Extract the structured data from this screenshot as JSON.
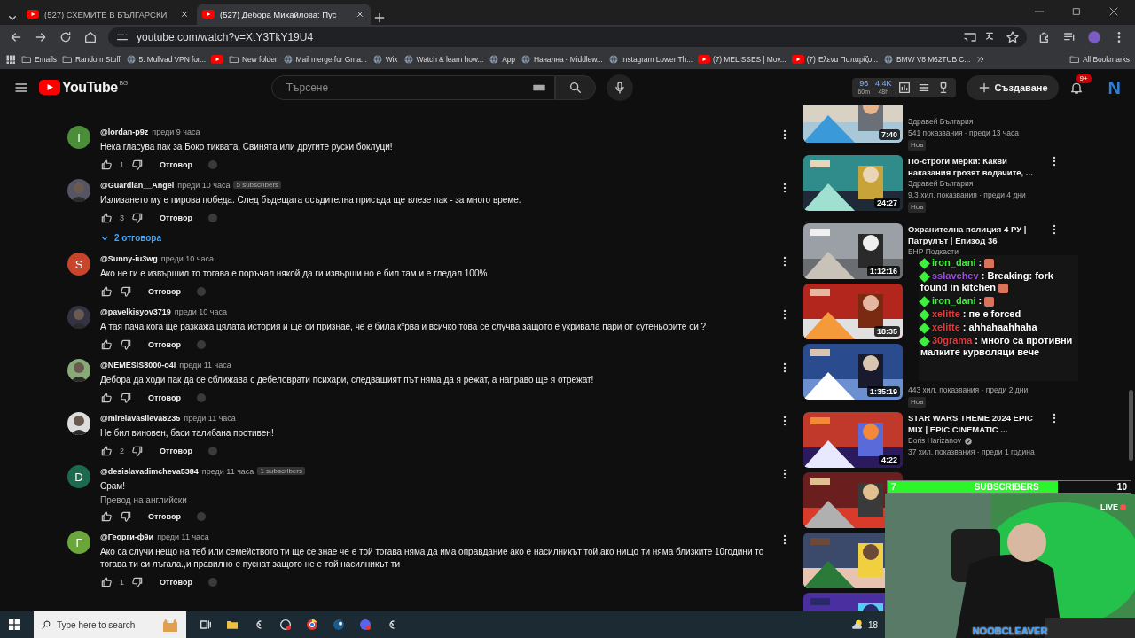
{
  "browser": {
    "tabs": [
      {
        "title": "(527) СХЕМИТЕ В БЪЛГАРСКИ",
        "selected": false
      },
      {
        "title": "(527) Дебора Михайлова: Пус",
        "selected": true
      }
    ],
    "url": "youtube.com/watch?v=XtY3TkY19U4",
    "bookmarks": [
      {
        "label": "Emails",
        "kind": "folder"
      },
      {
        "label": "Random Stuff",
        "kind": "folder"
      },
      {
        "label": "5. Mullvad VPN for...",
        "kind": "site"
      },
      {
        "kind": "youtube"
      },
      {
        "label": "New folder",
        "kind": "folder"
      },
      {
        "label": "Mail merge for Gma...",
        "kind": "site"
      },
      {
        "label": "Wix",
        "kind": "site"
      },
      {
        "label": "Watch & learn how...",
        "kind": "site"
      },
      {
        "label": "App",
        "kind": "site"
      },
      {
        "label": "Начална - Middlew...",
        "kind": "site"
      },
      {
        "label": "Instagram Lower Th...",
        "kind": "site"
      },
      {
        "label": "(7) MELISSES | Mov...",
        "kind": "youtube"
      },
      {
        "label": "(7) Έλενα Παπαρίζο...",
        "kind": "youtube"
      },
      {
        "label": "BMW V8 M62TUB C...",
        "kind": "site"
      }
    ],
    "all_bookmarks": "All Bookmarks"
  },
  "youtube": {
    "logo": "YouTube",
    "country": "BG",
    "search_placeholder": "Търсене",
    "stats": [
      {
        "value": "96",
        "period": "60m"
      },
      {
        "value": "4.4K",
        "period": "48h"
      }
    ],
    "create": "Създаване",
    "notifications": "9+",
    "avatar": "N"
  },
  "comments": [
    {
      "kind": "letter",
      "letter": "I",
      "color": "#4b8e3a",
      "author": "@lordan-p9z",
      "time": "преди 9 часа",
      "text": "Нека гласува пак за Боко тиквата, Свинята или другите руски боклуци!",
      "likes": "1",
      "reply": "Отговор"
    },
    {
      "kind": "picture",
      "author": "@Guardian__Angel",
      "time": "преди 10 часа",
      "badge": "5 subscribers",
      "text": "Излизането му е пирова победа. След бъдещата осъдителна присъда ще влезе пак - за много време.",
      "likes": "3",
      "reply": "Отговор",
      "replies": "2 отговора"
    },
    {
      "kind": "letter",
      "letter": "S",
      "color": "#c8442a",
      "author": "@Sunny-iu3wg",
      "time": "преди 10 часа",
      "text": "Ако не ги е извършил то тогава е поръчал някой да ги извърши но е бил там и е гледал 100%",
      "reply": "Отговор"
    },
    {
      "kind": "picture",
      "author": "@pavelkisyov3719",
      "time": "преди 10 часа",
      "text": "А тая пача кога ще разкажа цялата история и ще си признае, че е била к*рва и всичко това се случва защото е укривала пари от сутеньорите си ?",
      "reply": "Отговор"
    },
    {
      "kind": "picture",
      "author": "@NEMESIS8000-o4l",
      "time": "преди 11 часа",
      "text": "Дебора да ходи пак да се сближава с дебеловрати психари, следващият път няма да я  режат, а направо ще я отрежат!",
      "reply": "Отговор"
    },
    {
      "kind": "picture",
      "author": "@mirelavasileva8235",
      "time": "преди 11 часа",
      "text": "Не бил виновен, баси талибана противен!",
      "likes": "2",
      "reply": "Отговор"
    },
    {
      "kind": "letter",
      "letter": "D",
      "color": "#1d6a4e",
      "author": "@desislavadimcheva5384",
      "time": "преди 11 часа",
      "badge": "1 subscribers",
      "text": "Срам!",
      "translate": "Превод на английски",
      "reply": "Отговор"
    },
    {
      "kind": "letter",
      "letter": "Г",
      "color": "#6aa63a",
      "author": "@Георги-ф9и",
      "time": "преди 11 часа",
      "text": "Ако са случи нещо на теб или семейството ти ще се знае че е той тогава няма да има оправдание ако е насилникът той,ако нищо ти няма близките 10години то тогава ти си лъгала.,и правилно е пуснат защото не е той насилникът ти",
      "likes": "1",
      "reply": "Отговор"
    }
  ],
  "videos": [
    {
      "kind": "picture",
      "channel": "Здравей България",
      "meta": "541 показвания · преди 13 часа",
      "badge": "Нов",
      "duration": "7:40"
    },
    {
      "kind": "picture",
      "title": "По-строги мерки: Какви наказания грозят водачите, ...",
      "channel": "Здравей България",
      "meta": "9,3 хил. показвания · преди 4 дни",
      "badge": "Нов",
      "duration": "24:27"
    },
    {
      "kind": "picture",
      "title": "Охранителна полиция 4 РУ | Патрулът | Епизод 36",
      "channel": "БНР Подкасти",
      "duration": "1:12:16"
    },
    {
      "kind": "picture",
      "duration": "18:35"
    },
    {
      "kind": "picture",
      "meta": "443 хил. показвания · преди 2 дни",
      "badge": "Нов",
      "duration": "1:35:19"
    },
    {
      "kind": "picture",
      "title": "STAR WARS THEME 2024 EPIC MIX | EPIC CINEMATIC ...",
      "channel": "Boris Harizanov",
      "verified": true,
      "meta": "37 хил. показвания · преди 1 година",
      "duration": "4:22"
    },
    {
      "kind": "picture"
    },
    {
      "kind": "picture"
    },
    {
      "kind": "picture"
    }
  ],
  "chat": [
    {
      "user": "iron_dani",
      "color": "#3cf03c",
      "text": ":",
      "emote": true
    },
    {
      "user": "sslavchev",
      "color": "#9b4fe0",
      "text": ": Breaking: fork found in kitchen",
      "emote": true
    },
    {
      "user": "iron_dani",
      "color": "#3cf03c",
      "text": ":",
      "emote": true
    },
    {
      "user": "xelitte",
      "color": "#e23a3a",
      "text": ": пе е forced"
    },
    {
      "user": "xelitte",
      "color": "#e23a3a",
      "text": ": ahhahaahhaha"
    },
    {
      "user": "30grama",
      "color": "#e23a3a",
      "text": ": много са противни малките курволяци вече"
    }
  ],
  "subscriber_goal": {
    "current": "7",
    "label": "SUBSCRIBERS",
    "target": "10",
    "level": 0.7
  },
  "webcam": {
    "live": "LIVE",
    "name": "NOOBCLEAVER"
  },
  "taskbar": {
    "search_placeholder": "Type here to search",
    "temperature": "18"
  }
}
